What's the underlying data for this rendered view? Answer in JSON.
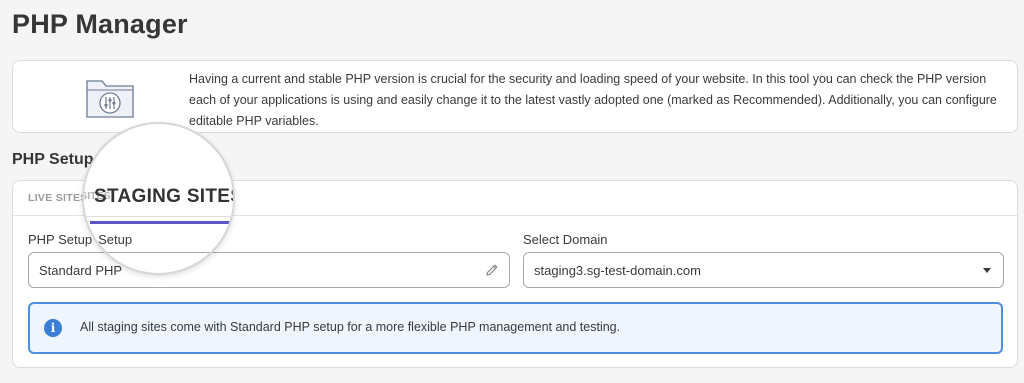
{
  "page": {
    "title": "PHP Manager"
  },
  "intro": {
    "icon": "folder-sliders-icon",
    "text": "Having a current and stable PHP version is crucial for the security and loading speed of your website. In this tool you can check the PHP version each of your applications is using and easily change it to the latest vastly adopted one (marked as Recommended). Additionally, you can configure editable PHP variables."
  },
  "setup": {
    "title": "PHP Setup",
    "tabs": [
      {
        "label": "LIVE SITES",
        "active": false
      },
      {
        "label": "STAGING SITES",
        "active": true
      }
    ],
    "php_setup": {
      "label": "PHP Setup",
      "value": "Standard PHP",
      "icon": "pencil-icon"
    },
    "domain": {
      "label": "Select Domain",
      "value": "staging3.sg-test-domain.com",
      "icon": "chevron-down-icon"
    },
    "info": {
      "icon": "info-icon",
      "text": "All staging sites come with Standard PHP setup for a more flexible PHP management and testing."
    }
  },
  "colors": {
    "accent": "#5b55c6",
    "info_border": "#4a8fe0",
    "info_icon": "#3a7fd5"
  }
}
